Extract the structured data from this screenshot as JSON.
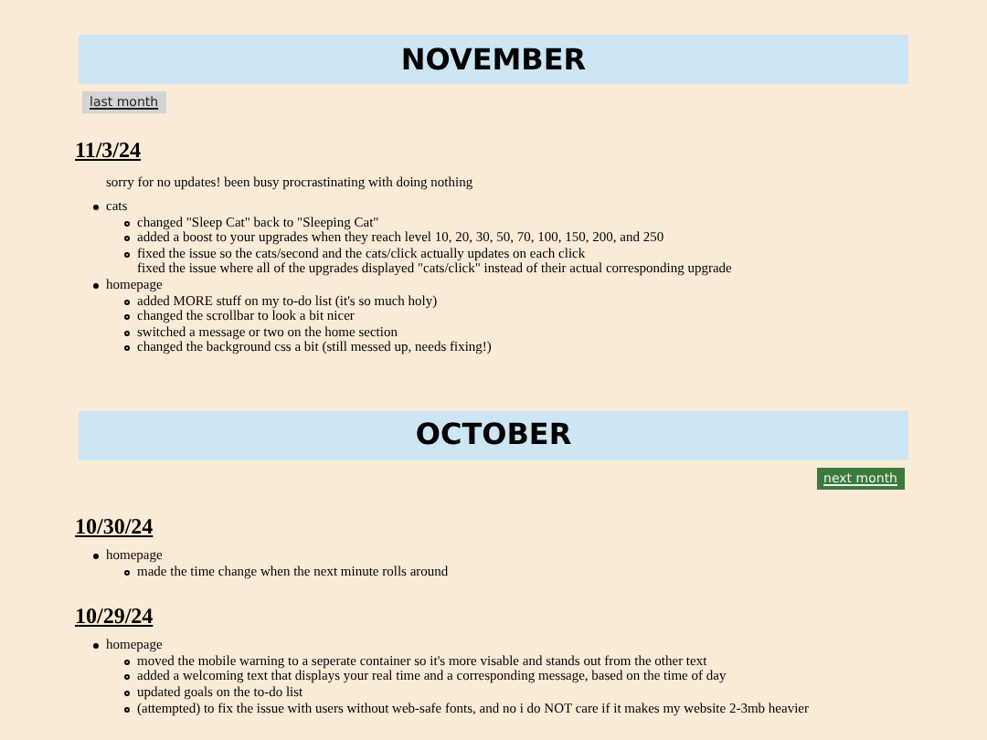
{
  "months": [
    {
      "title": "NOVEMBER",
      "nav": {
        "label": "last month",
        "kind": "previous"
      },
      "entries": [
        {
          "date": "11/3/24",
          "intro": "sorry for no updates! been busy procrastinating with doing nothing",
          "groups": [
            {
              "label": "cats",
              "items": [
                {
                  "text": "changed \"Sleep Cat\" back to \"Sleeping Cat\"",
                  "kind": "bullet"
                },
                {
                  "text": "added a boost to your upgrades when they reach level 10, 20, 30, 50, 70, 100, 150, 200, and 250",
                  "kind": "bullet"
                },
                {
                  "text": "fixed the issue so the cats/second and the cats/click actually updates on each click",
                  "kind": "bullet"
                },
                {
                  "text": "fixed the issue where all of the upgrades displayed \"cats/click\" instead of their actual corresponding upgrade",
                  "kind": "continuation"
                }
              ]
            },
            {
              "label": "homepage",
              "items": [
                {
                  "text": "added MORE stuff on my to-do list (it's so much holy)",
                  "kind": "bullet"
                },
                {
                  "text": "changed the scrollbar to look a bit nicer",
                  "kind": "bullet"
                },
                {
                  "text": "switched a message or two on the home section",
                  "kind": "bullet"
                },
                {
                  "text": "changed the background css a bit (still messed up, needs fixing!)",
                  "kind": "bullet"
                }
              ]
            }
          ]
        }
      ]
    },
    {
      "title": "OCTOBER",
      "nav": {
        "label": "next month",
        "kind": "next"
      },
      "entries": [
        {
          "date": "10/30/24",
          "groups": [
            {
              "label": "homepage",
              "items": [
                {
                  "text": "made the time change when the next minute rolls around",
                  "kind": "bullet"
                }
              ]
            }
          ]
        },
        {
          "date": "10/29/24",
          "groups": [
            {
              "label": "homepage",
              "items": [
                {
                  "text": "moved the mobile warning to a seperate container so it's more visable and stands out from the other text",
                  "kind": "bullet"
                },
                {
                  "text": "added a welcoming text that displays your real time and a corresponding message, based on the time of day",
                  "kind": "bullet"
                },
                {
                  "text": "updated goals on the to-do list",
                  "kind": "bullet"
                },
                {
                  "text": "(attempted) to fix the issue with users without web-safe fonts, and no i do NOT care if it makes my website 2-3mb heavier",
                  "kind": "bullet"
                }
              ]
            }
          ]
        }
      ]
    }
  ]
}
